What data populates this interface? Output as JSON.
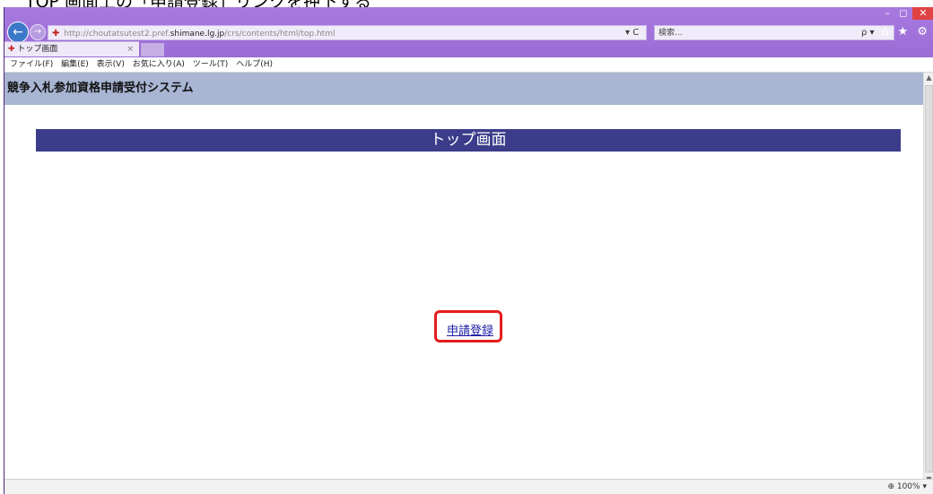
{
  "instruction_text": "TOP 画面上の「申請登録」リンクを押下する",
  "browser": {
    "url_prefix": "http://choutatsutest2.pref.",
    "url_domain": "shimane.lg.jp",
    "url_path": "/crs/contents/html/top.html",
    "refresh_label": "▾ C",
    "search_placeholder": "検索...",
    "search_dropdown": "ρ ▾",
    "tool_icons": "⌂ ★ ⚙",
    "tab_title": "トップ画面",
    "window_controls": {
      "minimize": "–",
      "maximize": "◻",
      "close": "✕"
    }
  },
  "menu": [
    "ファイル(F)",
    "編集(E)",
    "表示(V)",
    "お気に入り(A)",
    "ツール(T)",
    "ヘルプ(H)"
  ],
  "app": {
    "header_title": "競争入札参加資格申請受付システム",
    "banner_title": "トップ画面",
    "link_label": "申請登録"
  },
  "status": {
    "zoom": "100%"
  },
  "colors": {
    "titlebar": "#9b6cd6",
    "app_header": "#a8b5d3",
    "banner": "#3b3c8a",
    "link": "#1a1aa6",
    "highlight": "#e41c1c"
  }
}
